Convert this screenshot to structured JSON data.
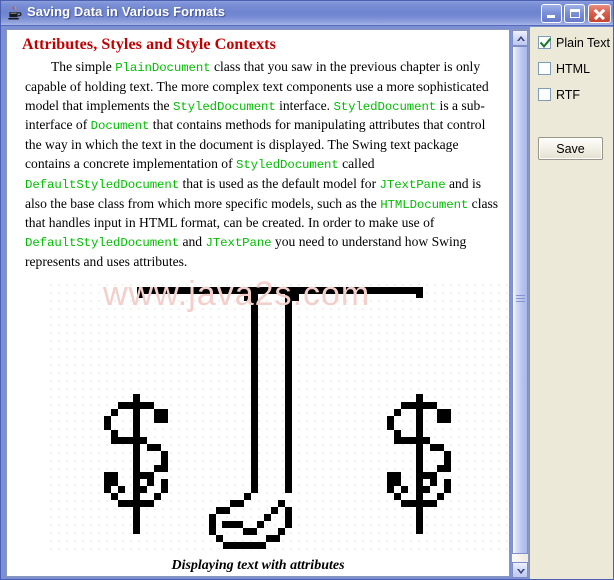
{
  "window": {
    "title": "Saving Data in Various Formats",
    "icon": "java-coffee-cup-icon",
    "minimize_label": "",
    "maximize_label": "",
    "close_label": ""
  },
  "document": {
    "heading": "Attributes, Styles and Style Contexts",
    "paragraph_runs": [
      {
        "text": "The simple ",
        "style": "normal"
      },
      {
        "text": "PlainDocument",
        "style": "code"
      },
      {
        "text": " class that you saw in the previous chapter is only capable of holding text. The more complex text components use a more sophisticated model that implements the ",
        "style": "normal"
      },
      {
        "text": "StyledDocument",
        "style": "code"
      },
      {
        "text": " interface. ",
        "style": "normal"
      },
      {
        "text": "StyledDocument",
        "style": "code"
      },
      {
        "text": " is a sub-interface of ",
        "style": "normal"
      },
      {
        "text": "Document",
        "style": "code"
      },
      {
        "text": " that contains methods for manipulating attributes that control the way in which the text in the document is displayed. The Swing text package contains a concrete implementation of ",
        "style": "normal"
      },
      {
        "text": "StyledDocument",
        "style": "code"
      },
      {
        "text": " called ",
        "style": "normal"
      },
      {
        "text": "DefaultStyledDocument",
        "style": "code"
      },
      {
        "text": " that is used as the default model for ",
        "style": "normal"
      },
      {
        "text": "JTextPane",
        "style": "code"
      },
      {
        "text": " and is also the base class from which more specific models, such as the ",
        "style": "normal"
      },
      {
        "text": "HTMLDocument",
        "style": "code"
      },
      {
        "text": " class that handles input in HTML format, can be created. In order to make use of ",
        "style": "normal"
      },
      {
        "text": "DefaultStyledDocument",
        "style": "code"
      },
      {
        "text": " and ",
        "style": "normal"
      },
      {
        "text": "JTextPane",
        "style": "code"
      },
      {
        "text": " you need to understand how Swing represents and uses attributes.",
        "style": "normal"
      }
    ],
    "figure_caption": "Displaying text with attributes",
    "figure_watermark": "www.java2s.com",
    "figure_rendered_text": "$J$",
    "colors": {
      "heading": "#c20000",
      "code": "#00c000",
      "body": "#000000",
      "watermark": "#f3cfcb"
    }
  },
  "options_panel": {
    "checkboxes": [
      {
        "label": "Plain Text",
        "checked": true
      },
      {
        "label": "HTML",
        "checked": false
      },
      {
        "label": "RTF",
        "checked": false
      }
    ],
    "save_label": "Save"
  },
  "scrollbar": {
    "orientation": "vertical",
    "up_arrow": "scroll-up",
    "down_arrow": "scroll-down"
  }
}
